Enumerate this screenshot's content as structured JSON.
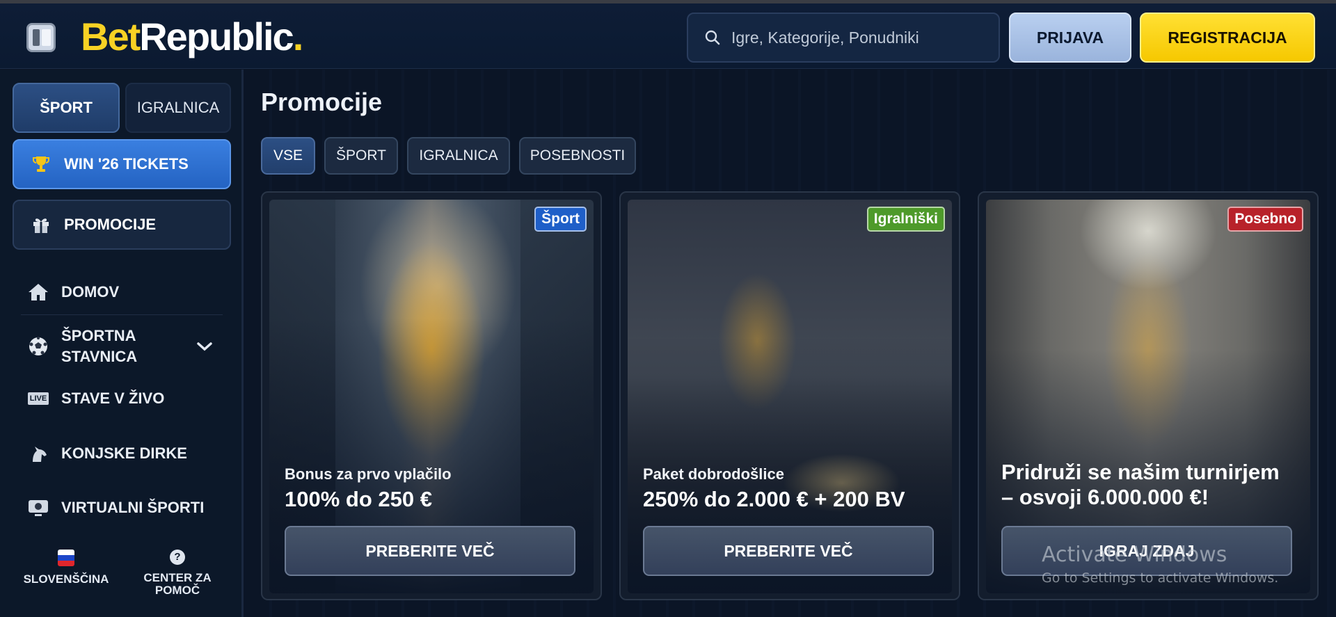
{
  "header": {
    "logo_bet": "Bet",
    "logo_republic": "Republic",
    "logo_dot": ".",
    "search_placeholder": "Igre, Kategorije, Ponudniki",
    "login_label": "PRIJAVA",
    "register_label": "REGISTRACIJA"
  },
  "sidebar": {
    "tabs": [
      {
        "label": "ŠPORT",
        "active": true
      },
      {
        "label": "IGRALNICA",
        "active": false
      }
    ],
    "win_label": "WIN '26 TICKETS",
    "promo_label": "PROMOCIJE",
    "nav": [
      {
        "label": "DOMOV",
        "icon": "home-icon"
      },
      {
        "label": "ŠPORTNA STAVNICA",
        "icon": "soccer-ball-icon"
      },
      {
        "label": "STAVE V ŽIVO",
        "icon": "live-icon",
        "icon_text": "LIVE"
      },
      {
        "label": "KONJSKE DIRKE",
        "icon": "horse-icon"
      },
      {
        "label": "VIRTUALNI ŠPORTI",
        "icon": "virtual-sport-icon"
      }
    ],
    "footer": {
      "language": "SLOVENŠČINA",
      "help_line1": "CENTER ZA",
      "help_line2": "POMOČ"
    }
  },
  "main": {
    "title": "Promocije",
    "filters": [
      {
        "label": "VSE",
        "active": true
      },
      {
        "label": "ŠPORT",
        "active": false
      },
      {
        "label": "IGRALNICA",
        "active": false
      },
      {
        "label": "POSEBNOSTI",
        "active": false
      }
    ],
    "cards": [
      {
        "badge": "Šport",
        "badge_color": "#1f5fc8",
        "subtitle": "Bonus za prvo vplačilo",
        "headline": "100% do 250 €",
        "button": "PREBERITE VEČ"
      },
      {
        "badge": "Igralniški",
        "badge_color": "#4e9a2a",
        "subtitle": "Paket dobrodošlice",
        "headline": "250% do 2.000 € + 200 BV",
        "button": "PREBERITE VEČ"
      },
      {
        "badge": "Posebno",
        "badge_color": "#b8222a",
        "subtitle": "",
        "headline": "Pridruži se našim turnirjem – osvoji 6.000.000 €!",
        "button": "IGRAJ ZDAJ"
      }
    ]
  },
  "watermark": {
    "line1": "Activate Windows",
    "line2": "Go to Settings to activate Windows."
  },
  "colors": {
    "brand_yellow": "#f8d224",
    "accent_blue": "#2f72d6",
    "background": "#0b1526"
  }
}
